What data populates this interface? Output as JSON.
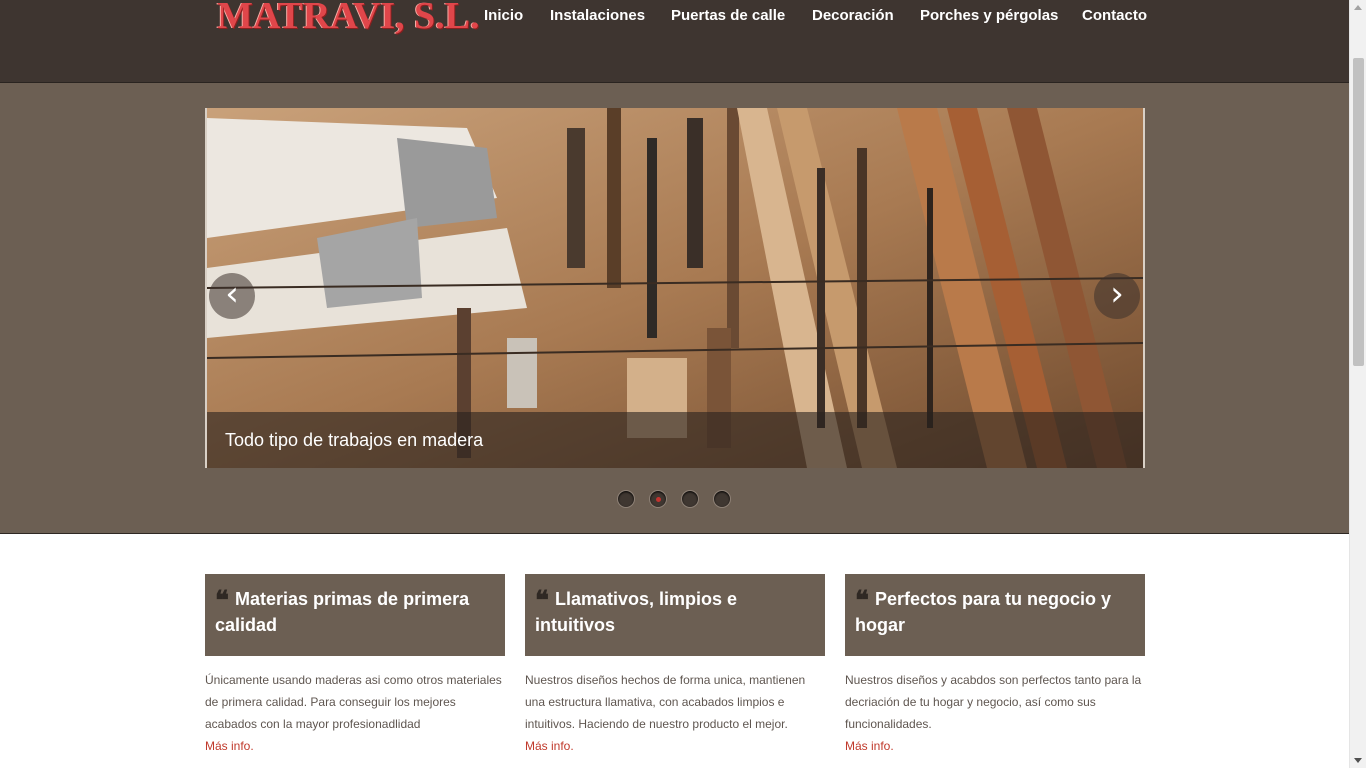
{
  "header": {
    "logo": "MATRAVI, S.L.",
    "nav": [
      "Inicio",
      "Instalaciones",
      "Puertas de calle",
      "Decoración",
      "Porches y pérgolas",
      "Contacto"
    ]
  },
  "slider": {
    "caption": "Todo tipo de trabajos en madera",
    "prev_icon": "‹",
    "next_icon": "›",
    "slide_count": 4,
    "active_slide": 2
  },
  "features": [
    {
      "title": "Materias primas de primera calidad",
      "text": "Únicamente usando maderas asi como otros materiales de primera calidad. Para conseguir los mejores acabados con la mayor profesionadlidad",
      "link": "Más info."
    },
    {
      "title": "Llamativos, limpios e intuitivos",
      "text": "Nuestros diseños hechos de forma unica, mantienen una estructura llamativa, con acabados limpios e intuitivos. Haciendo de nuestro producto el mejor.",
      "link": "Más info."
    },
    {
      "title": "Perfectos para tu negocio y hogar",
      "text": "Nuestros diseños y acabdos son perfectos tanto para la decriación de tu hogar y negocio, así como sus funcionalidades.",
      "link": "Más info."
    }
  ],
  "quote_mark": "❝",
  "colors": {
    "header": "#3e3530",
    "band": "#6c5f53",
    "accent": "#c0392b",
    "logo": "#e0464a"
  }
}
